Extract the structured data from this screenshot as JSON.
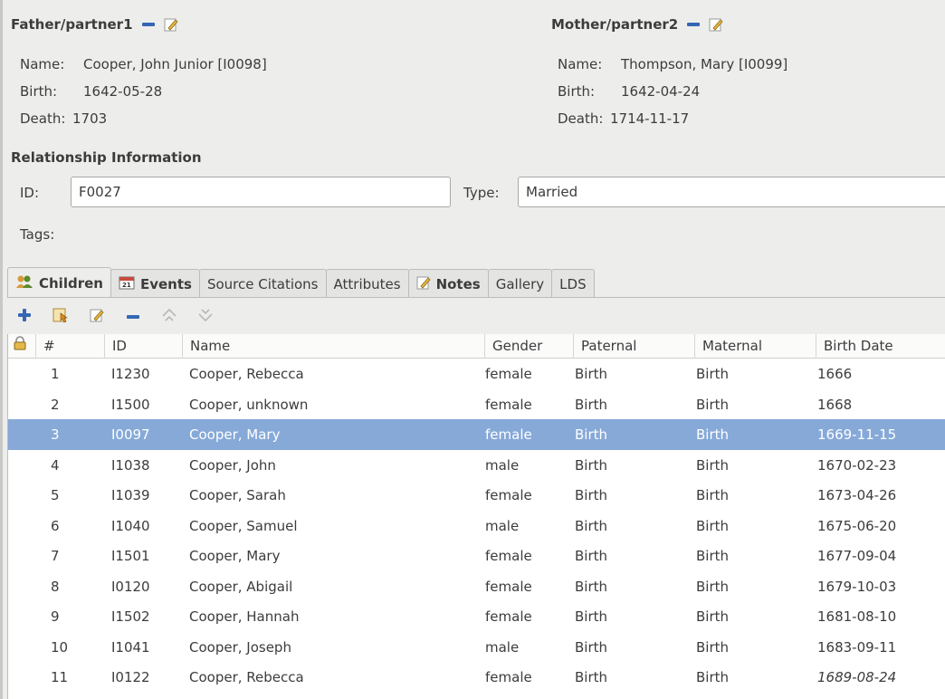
{
  "father": {
    "heading": "Father/partner1",
    "name_label": "Name:",
    "name": "Cooper, John Junior [I0098]",
    "birth_label": "Birth:",
    "birth": "1642-05-28",
    "death_label": "Death:",
    "death": "1703"
  },
  "mother": {
    "heading": "Mother/partner2",
    "name_label": "Name:",
    "name": "Thompson, Mary [I0099]",
    "birth_label": "Birth:",
    "birth": "1642-04-24",
    "death_label": "Death:",
    "death": "1714-11-17"
  },
  "relationship": {
    "heading": "Relationship Information",
    "id_label": "ID:",
    "id_value": "F0027",
    "type_label": "Type:",
    "type_value": "Married",
    "tags_label": "Tags:"
  },
  "tabs": [
    {
      "label": "Children",
      "icon": "family-icon"
    },
    {
      "label": "Events",
      "icon": "calendar-icon"
    },
    {
      "label": "Source Citations"
    },
    {
      "label": "Attributes"
    },
    {
      "label": "Notes",
      "icon": "note-icon"
    },
    {
      "label": "Gallery"
    },
    {
      "label": "LDS"
    }
  ],
  "columns": [
    "#",
    "ID",
    "Name",
    "Gender",
    "Paternal",
    "Maternal",
    "Birth Date"
  ],
  "rows": [
    {
      "n": "1",
      "id": "I1230",
      "name": "Cooper, Rebecca",
      "gender": "female",
      "paternal": "Birth",
      "maternal": "Birth",
      "birth": "1666"
    },
    {
      "n": "2",
      "id": "I1500",
      "name": "Cooper, unknown",
      "gender": "female",
      "paternal": "Birth",
      "maternal": "Birth",
      "birth": "1668"
    },
    {
      "n": "3",
      "id": "I0097",
      "name": "Cooper, Mary",
      "gender": "female",
      "paternal": "Birth",
      "maternal": "Birth",
      "birth": "1669-11-15"
    },
    {
      "n": "4",
      "id": "I1038",
      "name": "Cooper, John",
      "gender": "male",
      "paternal": "Birth",
      "maternal": "Birth",
      "birth": "1670-02-23"
    },
    {
      "n": "5",
      "id": "I1039",
      "name": "Cooper, Sarah",
      "gender": "female",
      "paternal": "Birth",
      "maternal": "Birth",
      "birth": "1673-04-26"
    },
    {
      "n": "6",
      "id": "I1040",
      "name": "Cooper, Samuel",
      "gender": "male",
      "paternal": "Birth",
      "maternal": "Birth",
      "birth": "1675-06-20"
    },
    {
      "n": "7",
      "id": "I1501",
      "name": "Cooper, Mary",
      "gender": "female",
      "paternal": "Birth",
      "maternal": "Birth",
      "birth": "1677-09-04"
    },
    {
      "n": "8",
      "id": "I0120",
      "name": "Cooper, Abigail",
      "gender": "female",
      "paternal": "Birth",
      "maternal": "Birth",
      "birth": "1679-10-03"
    },
    {
      "n": "9",
      "id": "I1502",
      "name": "Cooper, Hannah",
      "gender": "female",
      "paternal": "Birth",
      "maternal": "Birth",
      "birth": "1681-08-10"
    },
    {
      "n": "10",
      "id": "I1041",
      "name": "Cooper, Joseph",
      "gender": "male",
      "paternal": "Birth",
      "maternal": "Birth",
      "birth": "1683-09-11"
    },
    {
      "n": "11",
      "id": "I0122",
      "name": "Cooper, Rebecca",
      "gender": "female",
      "paternal": "Birth",
      "maternal": "Birth",
      "birth": "1689-08-24",
      "birth_italic": true
    }
  ],
  "selected_row": 3,
  "colors": {
    "selection": "#86a9d8",
    "accent": "#3467b3",
    "background": "#ededeb"
  }
}
